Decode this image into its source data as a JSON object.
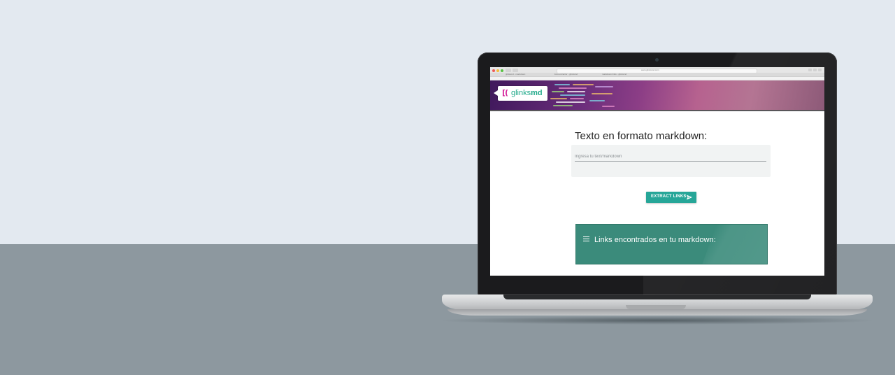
{
  "browser": {
    "address": "www.glinksmd.com",
    "tabs": [
      "glinksmd - markdown",
      "links extractor - glinksmd",
      "markdown links - glinksmd"
    ]
  },
  "app": {
    "logo_bracket": "[(",
    "logo_word": "glinks",
    "logo_word_bold": "md"
  },
  "form": {
    "title": "Texto en formato markdown:",
    "input_placeholder": "Ingresa tu text/markdown",
    "input_value": ""
  },
  "button": {
    "extract_label": "EXTRACT LINKS",
    "icon": "send-icon"
  },
  "results": {
    "title": "Links encontrados en tu markdown:",
    "icon": "menu-icon"
  },
  "colors": {
    "wall": "#e3e9f0",
    "desk": "#8d989f",
    "accent": "#26a698",
    "results_panel": "#3b8b7b",
    "logo_pink": "#d5219a",
    "logo_green": "#20a98a"
  }
}
